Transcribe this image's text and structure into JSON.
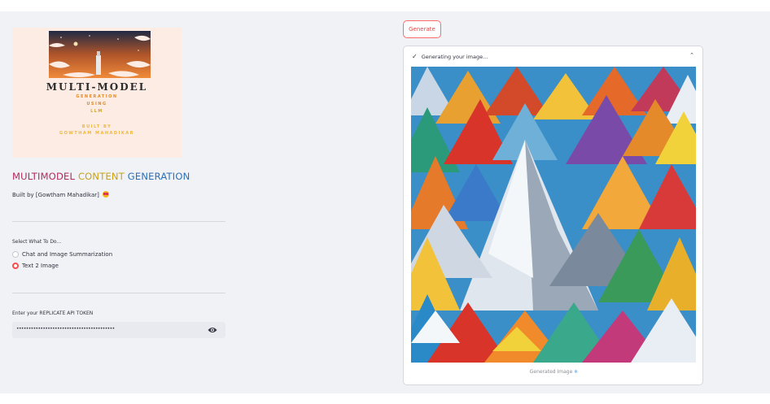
{
  "sidebar": {
    "logo": {
      "title": "MULTI-MODEL",
      "lines": [
        "GENERATION",
        "USING",
        "LLM"
      ],
      "footer": [
        "BUILT BY",
        "GOWTHAM MAHADIKAR"
      ]
    },
    "app_title_parts": [
      "MULTIMODEL ",
      "CONTENT ",
      "GENERATION"
    ],
    "built_by": "Built by [Gowtham Mahadikar]",
    "task_label": "Select What To Do...",
    "options": [
      {
        "label": "Chat and Image Summarization",
        "selected": false
      },
      {
        "label": "Text 2 Image",
        "selected": true
      }
    ],
    "token_label": "Enter your REPLICATE API TOKEN",
    "token_value": "•••••••••••••••••••••••••••••••••••••••••"
  },
  "main": {
    "generate_label": "Generate",
    "status": "Generating your image...",
    "caption": "Generated Image",
    "caption_emoji": "❄"
  },
  "colors": {
    "accent": "#ff4b4b",
    "sidebar_bg": "#f0f2f6",
    "title_pink": "#b22b5a",
    "title_gold": "#c9a21a",
    "title_blue": "#2c6fb8"
  }
}
